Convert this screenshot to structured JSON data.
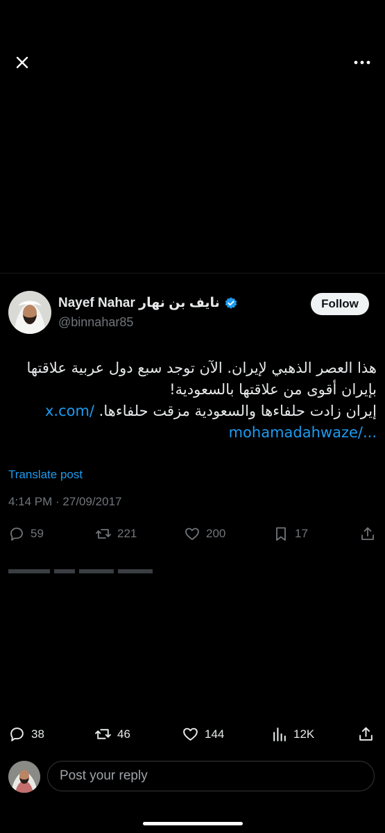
{
  "topbar": {
    "close_icon": "close-icon",
    "more_icon": "more-horizontal-icon"
  },
  "author": {
    "display_name": "Nayef Nahar نايف بن نهار",
    "handle": "@binnahar85",
    "verified_icon": "verified-badge-icon",
    "follow_label": "Follow"
  },
  "tweet": {
    "line1": "هذا العصر الذهبي لإيران. الآن توجد سبع دول عربية علاقتها",
    "line2": "بإيران أقوى من علاقتها بالسعودية!",
    "line3_text": "إيران زادت حلفاءها والسعودية مزقت حلفاءها. ",
    "line3_link": "x.com/",
    "line4_link": "mohamadahwaze/..."
  },
  "translate_label": "Translate post",
  "timestamp": "4:14 PM · 27/09/2017",
  "stats": {
    "replies": "59",
    "reposts": "221",
    "likes": "200",
    "bookmarks": "17"
  },
  "bottom_bar": {
    "replies": "38",
    "reposts": "46",
    "likes": "144",
    "views": "12K"
  },
  "reply": {
    "placeholder": "Post your reply"
  },
  "colors": {
    "background": "#000000",
    "accent": "#1d9bf0",
    "muted": "#71767b",
    "text": "#e7e9ea"
  }
}
